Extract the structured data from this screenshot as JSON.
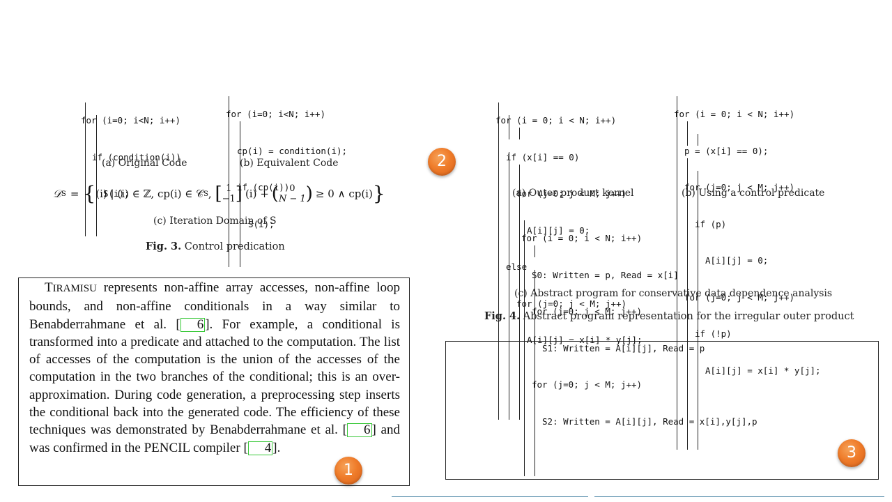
{
  "fig3": {
    "code_a": [
      "for (i=0; i<N; i++)",
      "if (condition(i))",
      "S(i);"
    ],
    "code_b": [
      "for (i=0; i<N; i++)",
      "cp(i) = condition(i);",
      "if (cp(i))",
      "S(i);"
    ],
    "caption_a": "(a) Original Code",
    "caption_b": "(b) Equivalent Code",
    "caption_c": "(c) Iteration Domain of S",
    "fig_label": "Fig. 3.",
    "fig_title": "Control predication",
    "equation": {
      "lhs": "𝒟",
      "lhs_sub": "S",
      "set_open": "(i) | (i) ∈ ℤ, cp(i) ∈ 𝒞",
      "set_sub": "S",
      "matrix_top": "1",
      "matrix_bottom": "−1",
      "mid": "(i) +",
      "vec_top": "0",
      "vec_bottom": "N − 1",
      "tail": "≥ 0 ∧ cp(i)"
    }
  },
  "fig4": {
    "code_a": [
      "for (i = 0; i < N; i++)",
      "if (x[i] == 0)",
      "for (j=0; j < M; j++)",
      "A[i][j] = 0;",
      "else",
      "for (j=0; j < M; j++)",
      "A[i][j] = x[i] * y[j];"
    ],
    "code_b": [
      "for (i = 0; i < N; i++)",
      "p = (x[i] == 0);",
      "for (j=0; j < M; j++)",
      "if (p)",
      "A[i][j] = 0;",
      "for (j=0; j < M; j++)",
      "if (!p)",
      "A[i][j] = x[i] * y[j];"
    ],
    "code_c": [
      "for (i = 0; i < N; i++)",
      "S0: Written = p, Read = x[i]",
      "for (j=0; j < M; j++)",
      "S1: Written = A[i][j], Read = p",
      "for (j=0; j < M; j++)",
      "S2: Written = A[i][j], Read = x[i],y[j],p"
    ],
    "caption_a": "(a) Outer product kernel",
    "caption_b": "(b) Using a control predicate",
    "caption_c": "(c) Abstract program for conservative data dependence analysis",
    "fig_label": "Fig. 4.",
    "fig_title": "Abstract program representation for the irregular outer product"
  },
  "paragraph": {
    "tiramisu_first": "T",
    "tiramisu_rest": "IRAMISU",
    "p1": " represents non-affine array accesses, non-affine loop bounds, and non-affine conditionals in a way similar to Benabderrahmane et al. [",
    "ref1": "6",
    "p2": "]. For example, a conditional is transformed into a predicate and attached to the computation. The list of accesses of the computation is the union of the accesses of the computation in the two branches of the conditional; this is an over-approximation. During code generation, a preprocessing step inserts the conditional back into the generated code. The efficiency of these techniques was demonstrated by Benabderrahmane et al. [",
    "ref2": "6",
    "p3": "] and was confirmed in the PENCIL compiler [",
    "ref3": "4",
    "p4": "]."
  },
  "badges": [
    "1",
    "2",
    "3"
  ],
  "colors": {
    "badge": "#ef7c2a",
    "ref_box": "#37c837",
    "underline": "#3f7ea0"
  }
}
